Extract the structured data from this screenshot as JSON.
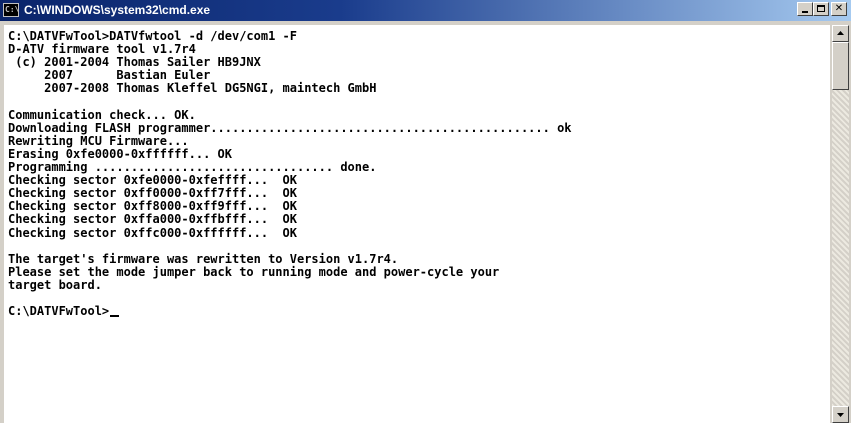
{
  "window": {
    "title": "C:\\WINDOWS\\system32\\cmd.exe",
    "icon_text": "C:\\",
    "titlebar_color": "#0a246a",
    "console_background": "#ffffff",
    "console_text_color": "#000000"
  },
  "titlebar_buttons": {
    "minimize": "minimize-icon",
    "maximize": "maximize-icon",
    "close": "close-icon",
    "close_glyph": "✕"
  },
  "console": {
    "lines": [
      "C:\\DATVFwTool>DATVfwtool -d /dev/com1 -F",
      "D-ATV firmware tool v1.7r4",
      " (c) 2001-2004 Thomas Sailer HB9JNX",
      "     2007      Bastian Euler",
      "     2007-2008 Thomas Kleffel DG5NGI, maintech GmbH",
      "",
      "Communication check... OK.",
      "Downloading FLASH programmer............................................... ok",
      "Rewriting MCU Firmware...",
      "Erasing 0xfe0000-0xffffff... OK",
      "Programming ................................. done.",
      "Checking sector 0xfe0000-0xfeffff...  OK",
      "Checking sector 0xff0000-0xff7fff...  OK",
      "Checking sector 0xff8000-0xff9fff...  OK",
      "Checking sector 0xffa000-0xffbfff...  OK",
      "Checking sector 0xffc000-0xffffff...  OK",
      "",
      "The target's firmware was rewritten to Version v1.7r4.",
      "Please set the mode jumper back to running mode and power-cycle your",
      "target board.",
      "",
      "C:\\DATVFwTool>"
    ]
  },
  "scrollbar": {
    "up_icon": "scroll-up-arrow-icon",
    "down_icon": "scroll-down-arrow-icon"
  }
}
